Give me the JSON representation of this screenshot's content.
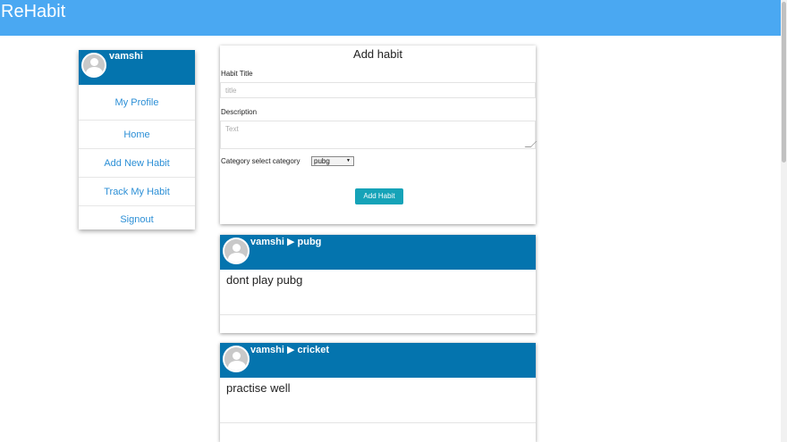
{
  "app": {
    "brand": "ReHabit"
  },
  "sidebar": {
    "username": "vamshi",
    "items": [
      {
        "label": "My Profile"
      },
      {
        "label": "Home"
      },
      {
        "label": "Add New Habit"
      },
      {
        "label": "Track My Habit"
      },
      {
        "label": "Signout"
      }
    ]
  },
  "form": {
    "title": "Add habit",
    "habit_title_label": "Habit Title",
    "habit_title_placeholder": "title",
    "description_label": "Description",
    "description_placeholder": "Text",
    "category_label": "Category select category",
    "category_selected": "pubg",
    "submit_label": "Add Habit"
  },
  "posts": [
    {
      "user": "vamshi",
      "separator": "▶",
      "category": "pubg",
      "text": "dont play pubg"
    },
    {
      "user": "vamshi",
      "separator": "▶",
      "category": "cricket",
      "text": "practise well"
    }
  ],
  "colors": {
    "topbar": "#4aa8f2",
    "card_header": "#0474ae",
    "link": "#2c8fd6",
    "button": "#16a3b8"
  }
}
